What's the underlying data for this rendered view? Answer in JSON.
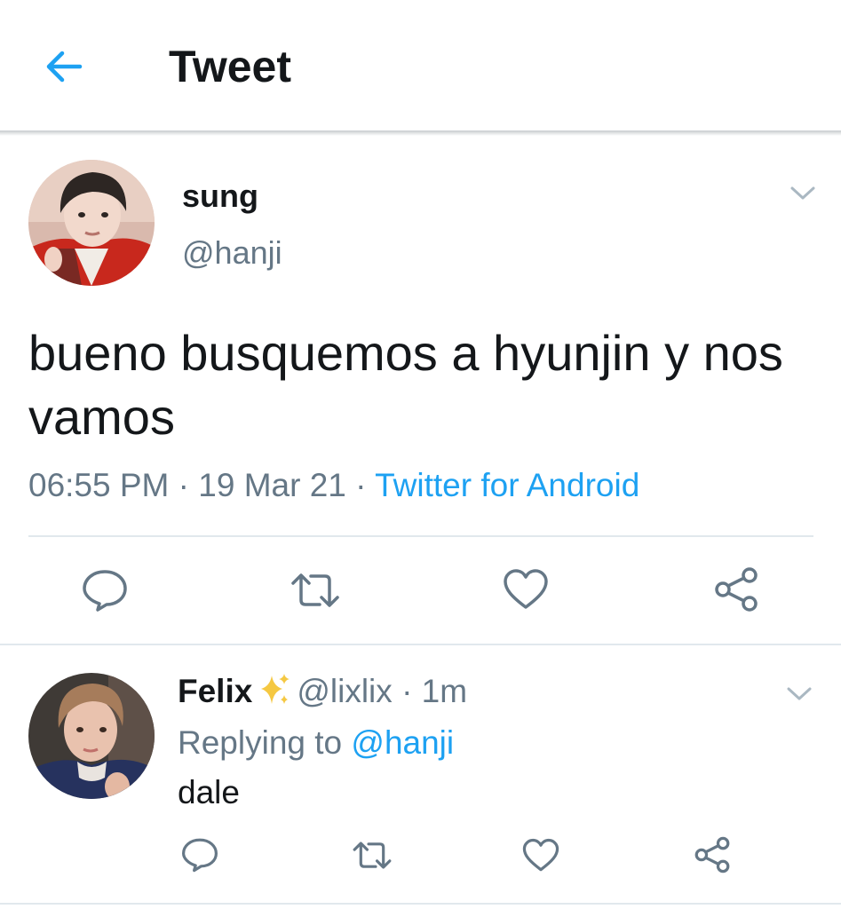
{
  "header": {
    "title": "Tweet",
    "back_icon": "arrow-left-icon",
    "accent": "#1da1f2"
  },
  "tweet": {
    "author_name": "sung",
    "author_handle": "@hanji",
    "text": "bueno busquemos a hyunjin y nos vamos",
    "time": "06:55 PM",
    "date": "19 Mar 21",
    "separator": "·",
    "source": "Twitter for Android",
    "actions": [
      "reply-icon",
      "retweet-icon",
      "like-icon",
      "share-icon"
    ]
  },
  "reply": {
    "author_name": "Felix",
    "badge_icon": "sparkles-icon",
    "author_handle": "@lixlix",
    "separator": "·",
    "time": "1m",
    "replying_prefix": "Replying to",
    "replying_to": "@hanji",
    "text": "dale",
    "actions": [
      "reply-icon",
      "retweet-icon",
      "like-icon",
      "share-icon"
    ]
  },
  "colors": {
    "text": "#14171a",
    "secondary": "#657786",
    "link": "#1da1f2",
    "divider": "#e1e8ed"
  }
}
